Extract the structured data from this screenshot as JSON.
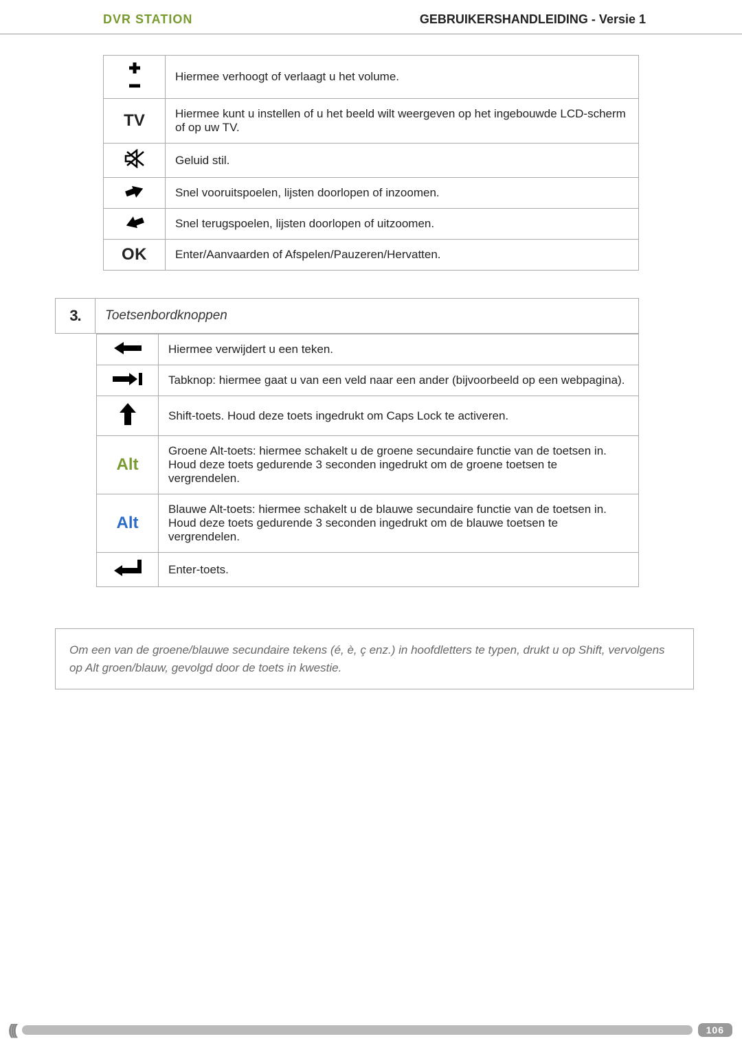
{
  "header": {
    "title_left": "DVR STATION",
    "title_right": "GEBRUIKERSHANDLEIDING - Versie 1"
  },
  "table1": {
    "rows": [
      {
        "icon": "plus-minus",
        "label_icon": "",
        "desc": "Hiermee verhoogt of verlaagt u het volume."
      },
      {
        "icon": "tv",
        "label_icon": "TV",
        "desc": "Hiermee kunt u instellen of u het beeld wilt weergeven op het ingebouwde LCD-scherm of op uw TV."
      },
      {
        "icon": "mute",
        "label_icon": "",
        "desc": "Geluid stil."
      },
      {
        "icon": "ffwd",
        "label_icon": "",
        "desc": "Snel vooruitspoelen, lijsten doorlopen of inzoomen."
      },
      {
        "icon": "rew",
        "label_icon": "",
        "desc": "Snel terugspoelen, lijsten doorlopen of uitzoomen."
      },
      {
        "icon": "ok",
        "label_icon": "OK",
        "desc": "Enter/Aanvaarden of Afspelen/Pauzeren/Hervatten."
      }
    ]
  },
  "section": {
    "number": "3.",
    "title": "Toetsenbordknoppen"
  },
  "table2": {
    "rows": [
      {
        "icon": "backspace",
        "desc": "Hiermee verwijdert u een teken."
      },
      {
        "icon": "tab",
        "desc": "Tabknop: hiermee gaat u van een veld naar een ander (bijvoorbeeld op een webpagina)."
      },
      {
        "icon": "shift",
        "desc": "Shift-toets. Houd deze toets ingedrukt om Caps Lock te activeren."
      },
      {
        "icon": "alt-green",
        "label": "Alt",
        "desc": "Groene Alt-toets: hiermee schakelt u de groene secundaire functie van de toetsen in. Houd deze toets gedurende 3 seconden ingedrukt om de groene toetsen te vergrendelen."
      },
      {
        "icon": "alt-blue",
        "label": "Alt",
        "desc": "Blauwe Alt-toets: hiermee schakelt u de blauwe secundaire functie van de toetsen in. Houd deze toets gedurende 3 seconden ingedrukt om de blauwe toetsen te vergrendelen."
      },
      {
        "icon": "enter",
        "desc": "Enter-toets."
      }
    ]
  },
  "note": "Om een van de groene/blauwe secundaire tekens (é, è, ç enz.) in hoofdletters te typen, drukt u op Shift, vervolgens op Alt groen/blauw, gevolgd door de toets in kwestie.",
  "footer": {
    "page": "106"
  }
}
